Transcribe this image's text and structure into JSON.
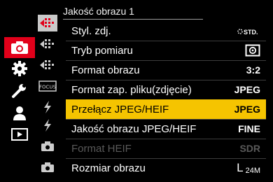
{
  "header": {
    "title": "Jakość obrazu 1"
  },
  "tabs": {
    "main": [
      {
        "icon": "camera-icon",
        "active": true
      },
      {
        "icon": "gear-icon",
        "active": false
      },
      {
        "icon": "wrench-icon",
        "active": false
      },
      {
        "icon": "person-icon",
        "active": false
      },
      {
        "icon": "playback-icon",
        "active": false
      }
    ],
    "sub": [
      {
        "icon": "page-1-icon",
        "active": true
      },
      {
        "icon": "page-2-icon",
        "active": false
      },
      {
        "icon": "page-3-icon",
        "active": false
      },
      {
        "icon": "focus-icon",
        "active": false,
        "label": "FOCUS"
      },
      {
        "icon": "flash-icon",
        "active": false
      },
      {
        "icon": "flash-icon",
        "active": false
      },
      {
        "icon": "camera-small-icon",
        "active": false
      },
      {
        "icon": "camera-small-icon",
        "active": false
      }
    ]
  },
  "menu": {
    "items": [
      {
        "label": "Styl. zdj.",
        "value_icon": "photo-style-std-icon",
        "value_text": "STD."
      },
      {
        "label": "Tryb pomiaru",
        "value_icon": "metering-icon"
      },
      {
        "label": "Format obrazu",
        "value": "3:2"
      },
      {
        "label": "Format zap. pliku(zdjęcie)",
        "value": "JPEG"
      },
      {
        "label": "Przełącz JPEG/HEIF",
        "value": "JPEG",
        "selected": true
      },
      {
        "label": "Jakość obrazu JPEG/HEIF",
        "value": "FINE"
      },
      {
        "label": "Format HEIF",
        "value": "SDR",
        "disabled": true
      },
      {
        "label": "Rozmiar obrazu",
        "value_size": "L",
        "value_size_small": "24M"
      }
    ]
  },
  "colors": {
    "accent": "#e2001a",
    "highlight": "#f5c400"
  }
}
